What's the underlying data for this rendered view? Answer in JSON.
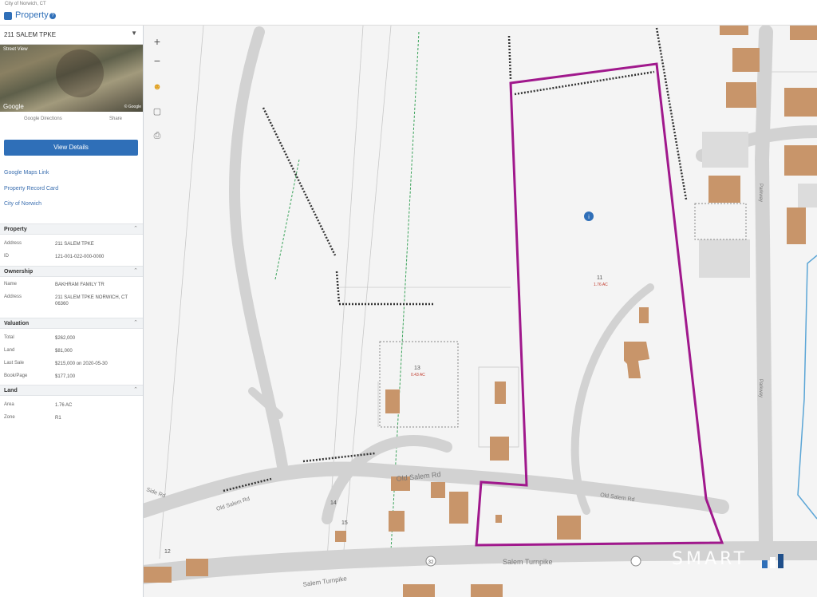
{
  "header": {
    "city": "City of Norwich, CT",
    "title": "Property",
    "help": "?"
  },
  "sidebar": {
    "address_select": "211 SALEM TPKE",
    "street_view_label": "Street View",
    "google_label": "Google",
    "street_view_copy": "© Google",
    "sv_link_left": "Google Directions",
    "sv_link_right": "Share",
    "view_details": "View Details",
    "links": [
      "Google Maps Link",
      "Property Record Card",
      "City of Norwich"
    ],
    "sections": {
      "property": {
        "title": "Property",
        "rows": [
          {
            "label": "Address",
            "value": "211 SALEM TPKE"
          },
          {
            "label": "ID",
            "value": "121-001-022-000-0000"
          }
        ]
      },
      "ownership": {
        "title": "Ownership",
        "rows": [
          {
            "label": "Name",
            "value": "BAKHRAM FAMILY TR"
          },
          {
            "label": "Address",
            "value": "211 SALEM TPKE NORWICH, CT 06360"
          }
        ]
      },
      "valuation": {
        "title": "Valuation",
        "rows": [
          {
            "label": "Total",
            "value": "$262,000"
          },
          {
            "label": "Land",
            "value": "$81,000"
          },
          {
            "label": "Last Sale",
            "value": "$215,000 on 2020-05-30"
          },
          {
            "label": "Book/Page",
            "value": "$177,100"
          }
        ]
      },
      "land": {
        "title": "Land",
        "rows": [
          {
            "label": "Area",
            "value": "1.76 AC"
          },
          {
            "label": "Zone",
            "value": "R1"
          }
        ]
      }
    }
  },
  "map": {
    "zoom_in": "+",
    "zoom_out": "−",
    "pegman": "☻",
    "tool_measure": "▢",
    "tool_print": "⎙",
    "road_labels": {
      "salem_tpke": "Salem Turnpike",
      "salem_rd": "Old Salem Rd",
      "salem_tpke_left": "Salem Turnpike",
      "salem_rd_left": "Old Salem Rd",
      "side_rd": "Side Rd",
      "right_rd": "Parkway",
      "right_rd2": "Parkway"
    },
    "parcel_labels": {
      "main_num": "11",
      "main_area": "1.76 AC",
      "p13": "13",
      "p13_area": "0.43 AC",
      "p14": "14",
      "p12": "12",
      "p15": "15"
    },
    "route_shield": "32",
    "brand": "SMART",
    "colors": {
      "selected_parcel": "#a0188c",
      "building": "#c8956a",
      "road": "#cfcfcf",
      "water": "#5aa5d6",
      "accent": "#2f6fb8"
    }
  }
}
